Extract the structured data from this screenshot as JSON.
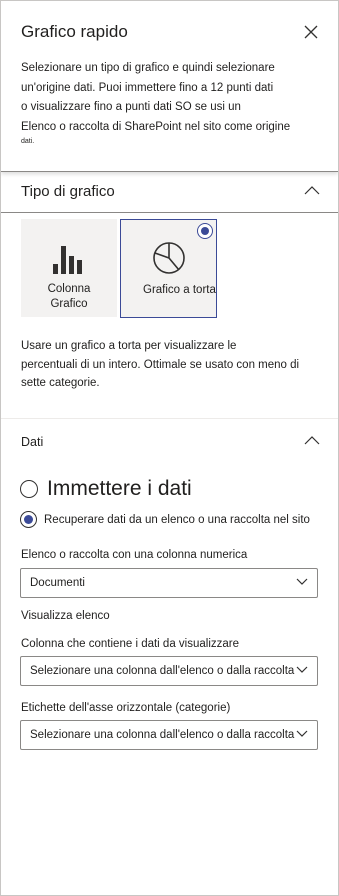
{
  "header": {
    "title": "Grafico rapido",
    "intro_line1": "Selezionare un tipo di grafico e quindi selezionare",
    "intro_line2": "un'origine dati. Puoi immettere fino a 12 punti dati",
    "intro_line3": "o visualizzare fino a punti dati SO se usi un",
    "intro_line4": "Elenco o raccolta di SharePoint nel sito come origine",
    "intro_line5": "dati."
  },
  "chart_type": {
    "heading": "Tipo di grafico",
    "tiles": [
      {
        "label_line1": "Colonna",
        "label_line2": "Grafico",
        "selected": false,
        "icon": "column-chart-icon"
      },
      {
        "label_line1": "Grafico a torta",
        "selected": true,
        "icon": "pie-chart-icon"
      }
    ],
    "desc_line1": "Usare un grafico a torta per visualizzare le",
    "desc_line2": "percentuali di un intero. Ottimale se usato con meno di",
    "desc_line3": "sette categorie."
  },
  "data_section": {
    "heading": "Dati",
    "option_enter": "Immettere i dati",
    "option_retrieve": "Recuperare dati da un elenco o una raccolta nel sito",
    "list_label": "Elenco o raccolta con una colonna numerica",
    "list_value": "Documenti",
    "view_list_link": "Visualizza elenco",
    "column_label": "Colonna che contiene i dati da visualizzare",
    "column_value": "Selezionare una colonna dall'elenco o dalla raccolta",
    "axis_label": "Etichette dell'asse orizzontale (categorie)",
    "axis_value": "Selezionare una colonna dall'elenco o dalla raccolta"
  },
  "colors": {
    "accent": "#3b4a97",
    "tile_bg": "#f3f2f1",
    "border": "#8a8886"
  }
}
